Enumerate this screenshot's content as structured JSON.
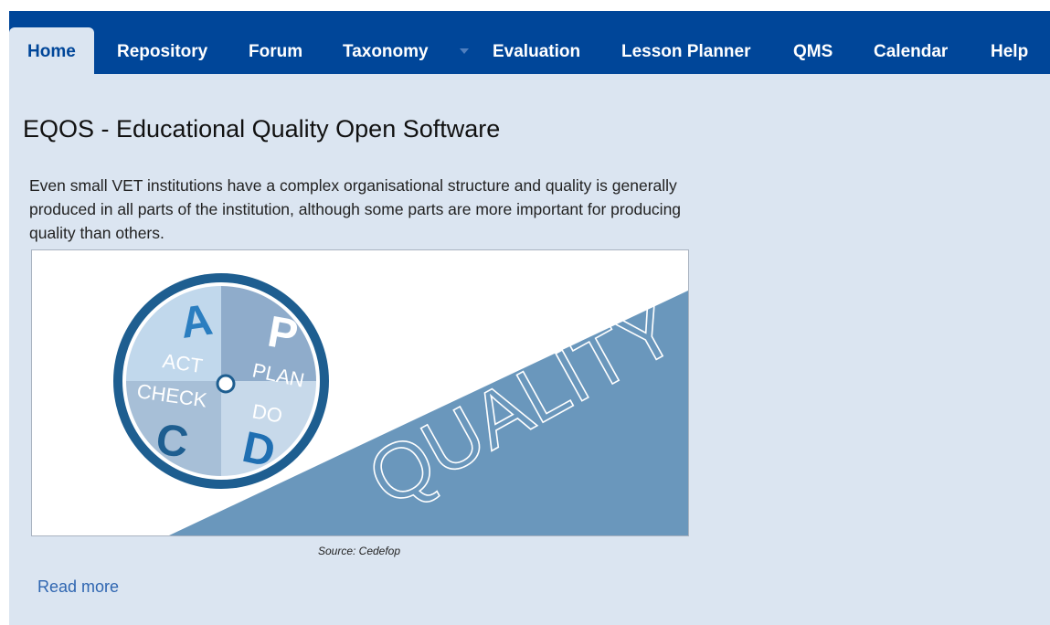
{
  "nav": {
    "tabs": [
      {
        "label": "Home",
        "active": true
      },
      {
        "label": "Repository"
      },
      {
        "label": "Forum"
      },
      {
        "label": "Taxonomy",
        "has_dropdown": true
      },
      {
        "label": "Evaluation"
      },
      {
        "label": "Lesson Planner"
      },
      {
        "label": "QMS"
      },
      {
        "label": "Calendar"
      },
      {
        "label": "Help"
      }
    ]
  },
  "main": {
    "title": "EQOS - Educational Quality Open Software",
    "intro": "Even small VET institutions have a complex organisational structure and quality is generally produced in all parts of the institution, although some parts are more important for producing quality than others.",
    "figure": {
      "quadrants": [
        {
          "letter": "A",
          "word": "ACT"
        },
        {
          "letter": "P",
          "word": "PLAN"
        },
        {
          "letter": "C",
          "word": "CHECK"
        },
        {
          "letter": "D",
          "word": "DO"
        }
      ],
      "banner_text": "QUALITY"
    },
    "caption": "Source: Cedefop",
    "read_more": "Read more"
  },
  "colors": {
    "nav_bar": "#004699",
    "page_bg": "#dbe5f1",
    "link": "#2f66b1",
    "banner": "#6a97bc"
  }
}
